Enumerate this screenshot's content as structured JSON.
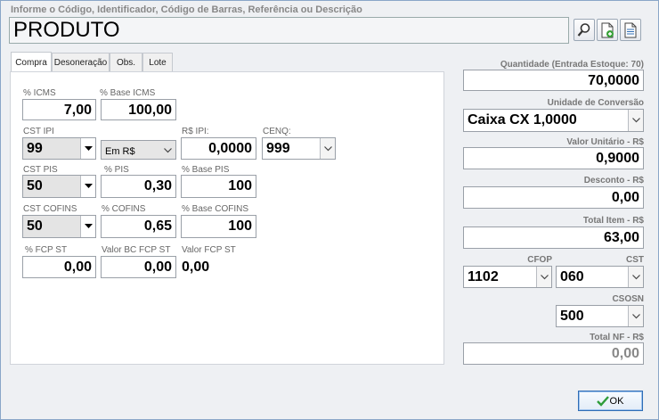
{
  "header": {
    "search_label": "Informe o Código, Identificador, Código de Barras, Referência ou Descrição",
    "search_value": "PRODUTO"
  },
  "tabs": [
    "Compra",
    "Desoneração",
    "Obs.",
    "Lote"
  ],
  "compra": {
    "icms_label": "% ICMS",
    "icms": "7,00",
    "base_icms_label": "% Base ICMS",
    "base_icms": "100,00",
    "cst_ipi_label": "CST IPI",
    "cst_ipi": "99",
    "ipi_tipo": "Em R$",
    "rs_ipi_label": "R$ IPI:",
    "rs_ipi": "0,0000",
    "cenq_label": "CENQ:",
    "cenq": "999",
    "cst_pis_label": "CST PIS",
    "cst_pis": "50",
    "pis_label": "% PIS",
    "pis": "0,30",
    "base_pis_label": "% Base PIS",
    "base_pis": "100",
    "cst_cofins_label": "CST COFINS",
    "cst_cofins": "50",
    "cofins_label": "% COFINS",
    "cofins": "0,65",
    "base_cofins_label": "% Base COFINS",
    "base_cofins": "100",
    "fcp_st_label": "% FCP ST",
    "fcp_st": "0,00",
    "valor_bc_fcp_st_label": "Valor BC FCP ST",
    "valor_bc_fcp_st": "0,00",
    "valor_fcp_st_label": "Valor FCP ST",
    "valor_fcp_st": "0,00"
  },
  "right": {
    "quantidade_label": "Quantidade (Entrada Estoque: 70)",
    "quantidade": "70,0000",
    "unidade_label": "Unidade de Conversão",
    "unidade": "Caixa CX 1,0000",
    "valor_unitario_label": "Valor Unitário - R$",
    "valor_unitario": "0,9000",
    "desconto_label": "Desconto - R$",
    "desconto": "0,00",
    "total_item_label": "Total Item - R$",
    "total_item": "63,00",
    "cfop_label": "CFOP",
    "cfop": "1102",
    "cst_label": "CST",
    "cst": "060",
    "csosn_label": "CSOSN",
    "csosn": "500",
    "total_nf_label": "Total NF - R$",
    "total_nf": "0,00"
  },
  "ok_label": "OK"
}
